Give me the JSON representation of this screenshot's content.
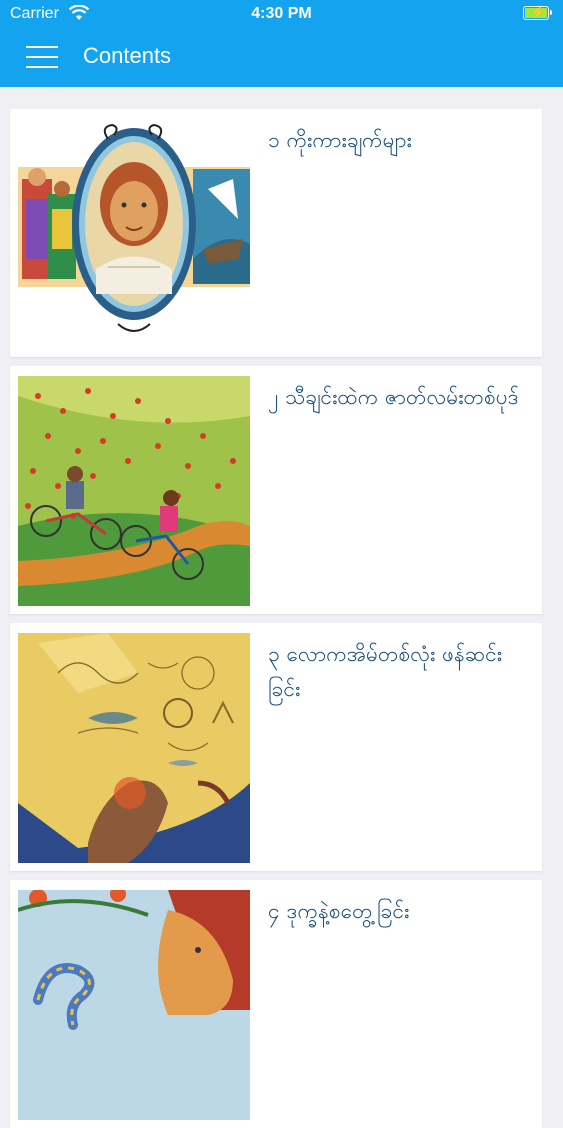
{
  "status_bar": {
    "carrier": "Carrier",
    "time": "4:30 PM"
  },
  "nav": {
    "title": "Contents",
    "menu_icon": "hamburger-menu-icon"
  },
  "colors": {
    "header_bg": "#14a4ef",
    "title_text": "#1a4f7a",
    "page_bg": "#efeff4"
  },
  "stories": [
    {
      "title": "၁ ကိုးကားချက်များ"
    },
    {
      "title": "၂ သီချင်းထဲက ဇာတ်လမ်းတစ်ပုဒ်"
    },
    {
      "title": "၃ လောကအိမ်တစ်လုံး ဖန်ဆင်းခြင်း"
    },
    {
      "title": "၄ ဒုက္ခနဲ့စတွေ့ခြင်း"
    }
  ]
}
